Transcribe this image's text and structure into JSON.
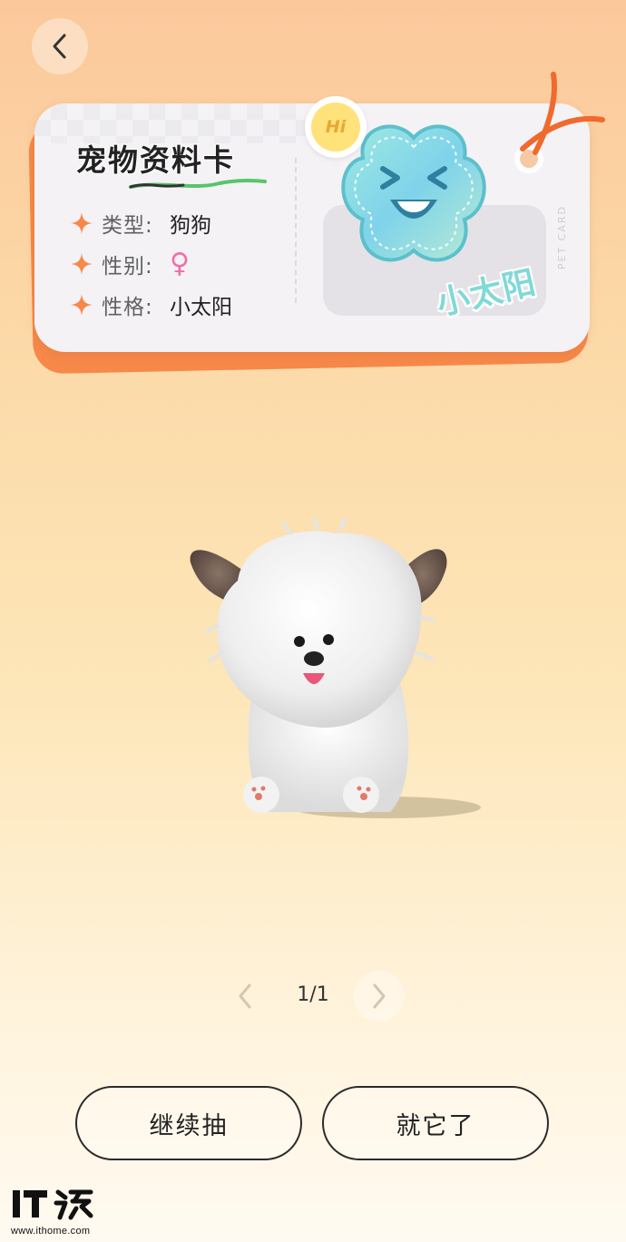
{
  "card": {
    "title": "宠物资料卡",
    "rows": [
      {
        "label": "类型:",
        "value": "狗狗"
      },
      {
        "label": "性别:",
        "value": "♀"
      },
      {
        "label": "性格:",
        "value": "小太阳"
      }
    ],
    "patch_name": "小太阳",
    "badge_text": "Hi",
    "side_text": "PET CARD"
  },
  "pager": {
    "count": "1/1"
  },
  "actions": {
    "continue_label": "继续抽",
    "confirm_label": "就它了"
  },
  "watermark": {
    "url": "www.ithome.com"
  },
  "colors": {
    "accent": "#f6884a",
    "gender_female": "#ee6fa8",
    "patch": "#7fd9d8"
  }
}
